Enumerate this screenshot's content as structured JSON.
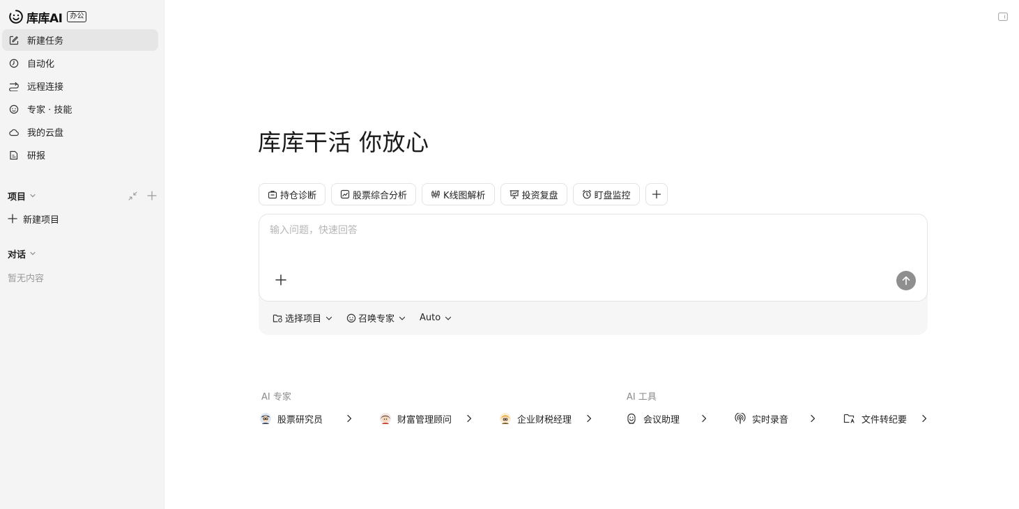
{
  "app": {
    "name": "库库AI",
    "badge": "办公"
  },
  "sidebar": {
    "nav": [
      {
        "label": "新建任务",
        "icon": "edit-icon",
        "active": true
      },
      {
        "label": "自动化",
        "icon": "clock-icon"
      },
      {
        "label": "远程连接",
        "icon": "remote-connect-icon"
      },
      {
        "label": "专家 · 技能",
        "icon": "expert-icon"
      },
      {
        "label": "我的云盘",
        "icon": "cloud-icon"
      },
      {
        "label": "研报",
        "icon": "report-icon"
      }
    ],
    "projects": {
      "title": "项目",
      "new_label": "新建项目"
    },
    "conversations": {
      "title": "对话",
      "empty_label": "暂无内容"
    }
  },
  "main": {
    "headline": "库库干活 你放心",
    "chips": [
      {
        "label": "持仓诊断",
        "icon": "portfolio-icon"
      },
      {
        "label": "股票综合分析",
        "icon": "trend-chart-icon"
      },
      {
        "label": "K线图解析",
        "icon": "candlestick-icon"
      },
      {
        "label": "投资复盘",
        "icon": "presentation-icon"
      },
      {
        "label": "盯盘监控",
        "icon": "alarm-icon"
      }
    ],
    "composer": {
      "placeholder": "输入问题，快速回答",
      "value": ""
    },
    "options": [
      {
        "label": "选择项目",
        "icon": "project-folder-icon"
      },
      {
        "label": "召唤专家",
        "icon": "expert-icon"
      },
      {
        "label": "Auto",
        "icon": ""
      }
    ],
    "experts": {
      "title": "AI 专家",
      "items": [
        {
          "label": "股票研究员",
          "icon": "stock-researcher-avatar-icon"
        },
        {
          "label": "财富管理顾问",
          "icon": "wealth-advisor-avatar-icon"
        },
        {
          "label": "企业财税经理",
          "icon": "tax-manager-avatar-icon"
        }
      ]
    },
    "tools": {
      "title": "AI 工具",
      "items": [
        {
          "label": "会议助理",
          "icon": "meeting-assistant-icon"
        },
        {
          "label": "实时录音",
          "icon": "podcast-icon"
        },
        {
          "label": "文件转纪要",
          "icon": "folder-doc-icon"
        }
      ]
    }
  },
  "colors": {
    "sidebar_bg": "#f4f4f4",
    "active_item_bg": "#e6e6e6",
    "send_button": "#8f8f8f"
  }
}
